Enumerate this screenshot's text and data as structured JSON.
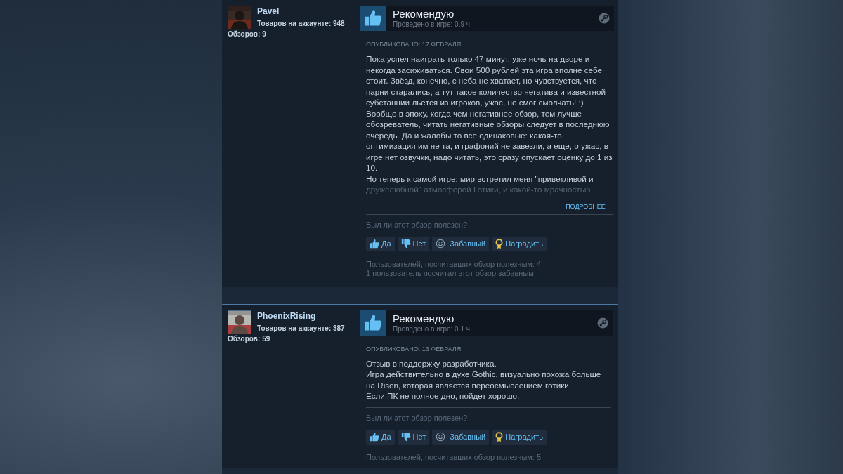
{
  "reviews": [
    {
      "user": {
        "name": "Pavel",
        "products": "Товаров на аккаунте: 948",
        "reviews": "Обзоров: 9"
      },
      "verdict": "Рекомендую",
      "recommended": true,
      "playtime": "Проведено в игре: 0.9 ч.",
      "posted": "ОПУБЛИКОВАНО: 17 ФЕВРАЛЯ",
      "lines": [
        {
          "text": "Пока успел наиграть только 47 минут, уже ночь на дворе и",
          "faded": false
        },
        {
          "text": "некогда засиживаться. Свои 500 рублей эта игра вполне себе",
          "faded": false
        },
        {
          "text": "стоит. Звёзд, конечно, с неба не хватает, но чувствуется, что",
          "faded": false
        },
        {
          "text": "парни старались, а тут такое количество негатива и известной",
          "faded": false
        },
        {
          "text": "субстанции льётся из игроков, ужас, не смог смолчать! :)",
          "faded": false
        },
        {
          "text": "Вообще в эпоху, когда чем негативнее обзор, тем лучше",
          "faded": false
        },
        {
          "text": "обозреватель, читать негативные обзоры следует в последнюю",
          "faded": false
        },
        {
          "text": "очередь. Да и жалобы то все одинаковые: какая-то",
          "faded": false
        },
        {
          "text": "оптимизация им не та, и графоний не завезли, а еще, о ужас, в",
          "faded": false
        },
        {
          "text": "игре нет озвучки, надо читать, это сразу опускает оценку до 1 из",
          "faded": false
        },
        {
          "text": "10.",
          "faded": false
        },
        {
          "text": "Но теперь к самой игре: мир встретил меня \"приветливой и",
          "faded": false
        },
        {
          "text": "дружелюбной\" атмосферой Готики, и какой-то мрачностью",
          "faded": true
        }
      ],
      "more": "ПОДРОБНЕЕ",
      "question": "Был ли этот обзор полезен?",
      "buttons": [
        {
          "kind": "yes",
          "label": "Да"
        },
        {
          "kind": "no",
          "label": "Нет"
        },
        {
          "kind": "funny",
          "label": "Забавный"
        },
        {
          "kind": "award",
          "label": "Наградить"
        }
      ],
      "stats": [
        "Пользователей, посчитавших обзор полезным: 4",
        "1 пользователь посчитал этот обзор забавным"
      ]
    },
    {
      "user": {
        "name": "PhoenixRising",
        "products": "Товаров на аккаунте: 387",
        "reviews": "Обзоров: 59"
      },
      "verdict": "Рекомендую",
      "recommended": true,
      "playtime": "Проведено в игре: 0.1 ч.",
      "posted": "ОПУБЛИКОВАНО: 16 ФЕВРАЛЯ",
      "lines": [
        {
          "text": "Отзыв в поддержку разработчика.",
          "faded": false
        },
        {
          "text": "Игра действительно в духе Gothic, визуально похожа больше",
          "faded": false
        },
        {
          "text": "на Risen, которая является переосмыслением готики.",
          "faded": false
        },
        {
          "text": "Если ПК не полное дно, пойдет хорошо.",
          "faded": false
        }
      ],
      "question": "Был ли этот обзор полезен?",
      "buttons": [
        {
          "kind": "yes",
          "label": "Да"
        },
        {
          "kind": "no",
          "label": "Нет"
        },
        {
          "kind": "funny",
          "label": "Забавный"
        },
        {
          "kind": "award",
          "label": "Наградить"
        }
      ],
      "stats": [
        "Пользователей, посчитавших обзор полезным: 5"
      ]
    }
  ]
}
